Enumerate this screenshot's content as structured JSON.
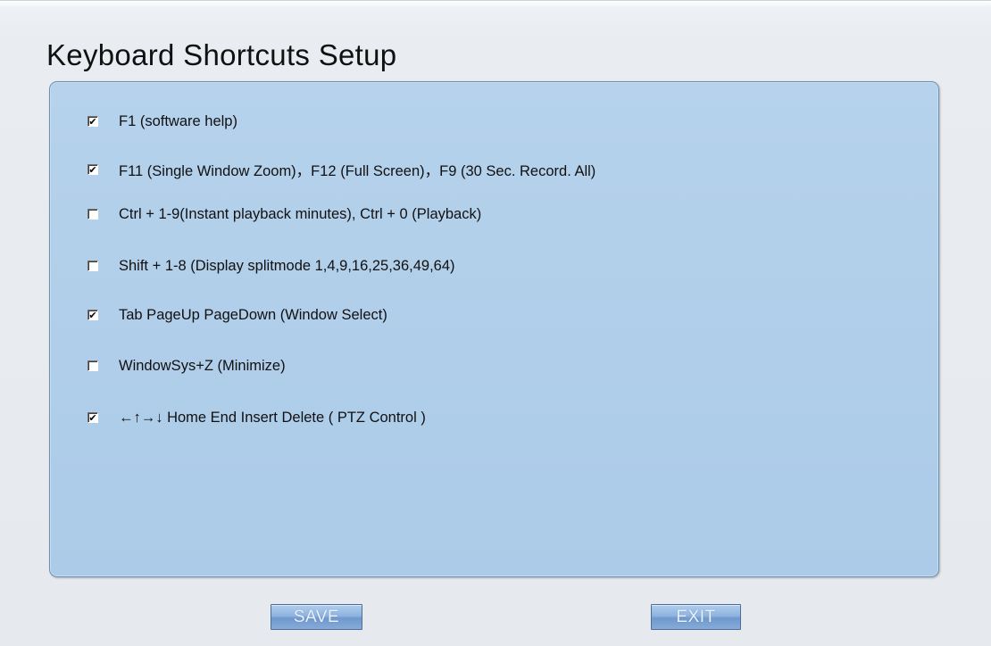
{
  "page": {
    "title": "Keyboard Shortcuts Setup"
  },
  "options": [
    {
      "label": "F1 (software help)",
      "checked": true
    },
    {
      "label": "F11 (Single Window Zoom)，F12 (Full Screen)，F9  (30 Sec. Record. All)",
      "checked": true
    },
    {
      "label": "Ctrl + 1-9(Instant playback minutes), Ctrl + 0 (Playback)",
      "checked": false
    },
    {
      "label": "Shift + 1-8 (Display splitmode 1,4,9,16,25,36,49,64)",
      "checked": false
    },
    {
      "label": "Tab PageUp PageDown (Window Select)",
      "checked": true
    },
    {
      "label": "WindowSys+Z (Minimize)",
      "checked": false
    },
    {
      "label": "←↑→↓  Home End  Insert  Delete ( PTZ Control )",
      "checked": true
    }
  ],
  "check_mark": "✔",
  "buttons": {
    "save_label": "SAVE",
    "exit_label": "EXIT"
  },
  "colors": {
    "panel": "#b0cde9",
    "button": "#8fb3df",
    "button_text": "#e9f1fb"
  }
}
